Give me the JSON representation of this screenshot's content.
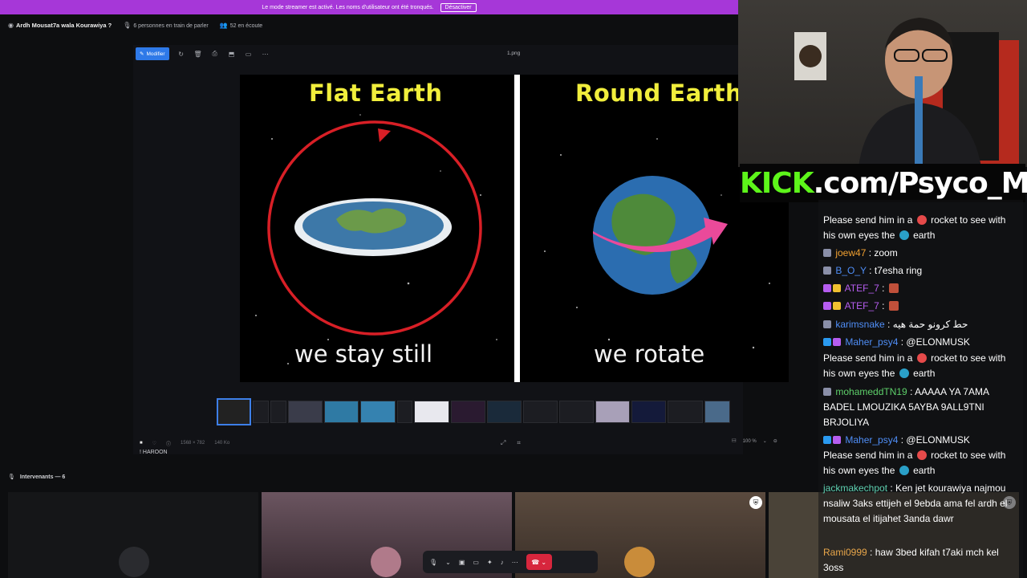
{
  "banner": {
    "text": "Le mode streamer est activé. Les noms d'utilisateur ont été tronqués.",
    "button": "Désactiver"
  },
  "channel": {
    "title": "Ardh Mousat7a wala Kourawiya ?",
    "speaking": "6 personnes en train de parler",
    "listening": "52 en écoute"
  },
  "viewer": {
    "modify_label": "Modifier",
    "filename": "1.png",
    "image": {
      "left_title": "Flat Earth",
      "right_title": "Round Earth",
      "left_caption": "we stay still",
      "right_caption": "we rotate"
    },
    "dimensions": "1568 × 782",
    "filesize": "140 Ko",
    "zoom": "100 %",
    "owner": "! HAROON"
  },
  "speakers": {
    "label": "Intervenants — 6"
  },
  "overlay": {
    "kick_prefix": "KICK",
    "kick_suffix": ".com/Psyco_M"
  },
  "chat": {
    "messages": [
      {
        "user": "",
        "text": "Please send him in a",
        "emoji1": "rocket",
        "text2": "rocket to see with his own eyes the",
        "emoji2": "globe",
        "text3": "earth",
        "color": "#ffffff"
      },
      {
        "user": "joew47",
        "text": ": zoom",
        "color": "#f0a030"
      },
      {
        "user": "B_O_Y",
        "text": ": t7esha ring",
        "color": "#4f8ef7"
      },
      {
        "user": "ATEF_7",
        "text": ":",
        "color": "#b65df0"
      },
      {
        "user": "ATEF_7",
        "text": ":",
        "color": "#b65df0"
      },
      {
        "user": "karimsnake",
        "text": ": حط كرونو حمة هيه",
        "color": "#4f8ef7"
      },
      {
        "user": "Maher_psy4",
        "text": ": @ELONMUSK",
        "color": "#4f8ef7"
      },
      {
        "user": "",
        "text": "Please send him in a",
        "text2": "rocket to see with his own eyes the",
        "text3": "earth",
        "color": "#ffffff"
      },
      {
        "user": "mohameddTN19",
        "text": ": AAAAA YA 7AMA BADEL LMOUZIKA 5AYBA 9ALL9TNI BRJOLIYA",
        "color": "#5ed06a"
      },
      {
        "user": "Maher_psy4",
        "text": ": @ELONMUSK",
        "color": "#4f8ef7"
      },
      {
        "user": "",
        "text": "Please send him in a",
        "text2": "rocket to see with his own eyes the",
        "text3": "earth",
        "color": "#ffffff"
      },
      {
        "user": "jackmakechpot",
        "text": ": Ken jet kourawiya najmou nsaliw 3aks ettijeh el 9ebda ama fel ardh el mousata el itijahet 3anda dawr",
        "color": "#5ed0b0"
      },
      {
        "user": "Rami0999",
        "text": ": haw 3bed kifah t7aki mch kel 3oss",
        "color": "#e8a64a"
      }
    ]
  },
  "colors": {
    "banner": "#a637d8",
    "accent": "#2e79e8",
    "hangup": "#d7263d",
    "kick_green": "#5df51a",
    "flat_title": "#f1ee3c"
  }
}
